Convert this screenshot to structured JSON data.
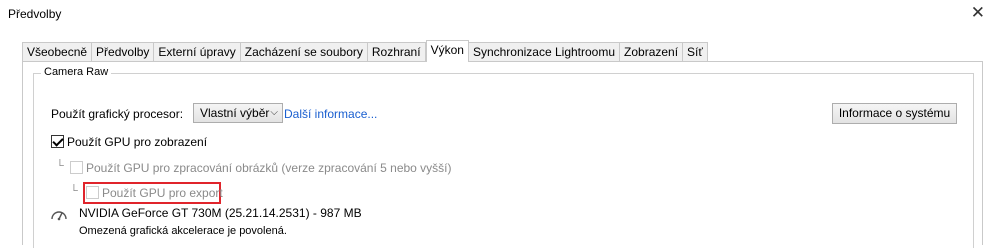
{
  "window": {
    "title": "Předvolby",
    "close_glyph": "✕"
  },
  "tabs": [
    "Všeobecně",
    "Předvolby",
    "Externí úpravy",
    "Zacházení se soubory",
    "Rozhraní",
    "Výkon",
    "Synchronizace Lightroomu",
    "Zobrazení",
    "Síť"
  ],
  "active_tab": "Výkon",
  "camera_raw": {
    "group_label": "Camera Raw",
    "gpu_label": "Použít grafický procesor:",
    "gpu_select_value": "Vlastní výběr",
    "more_info_link": "Další informace...",
    "system_info_button": "Informace o systému",
    "use_gpu_display": "Použít GPU pro zobrazení",
    "use_gpu_processing": "Použít GPU pro zpracování obrázků (verze zpracování 5 nebo vyšší)",
    "use_gpu_export": "Použít GPU pro export",
    "tree_glyph": "└",
    "gpu_name": "NVIDIA GeForce GT 730M (25.21.14.2531) - 987 MB",
    "gpu_status": "Omezená grafická akcelerace je povolená."
  },
  "colors": {
    "highlight_border": "#e0242b",
    "link": "#1a5fd0"
  }
}
